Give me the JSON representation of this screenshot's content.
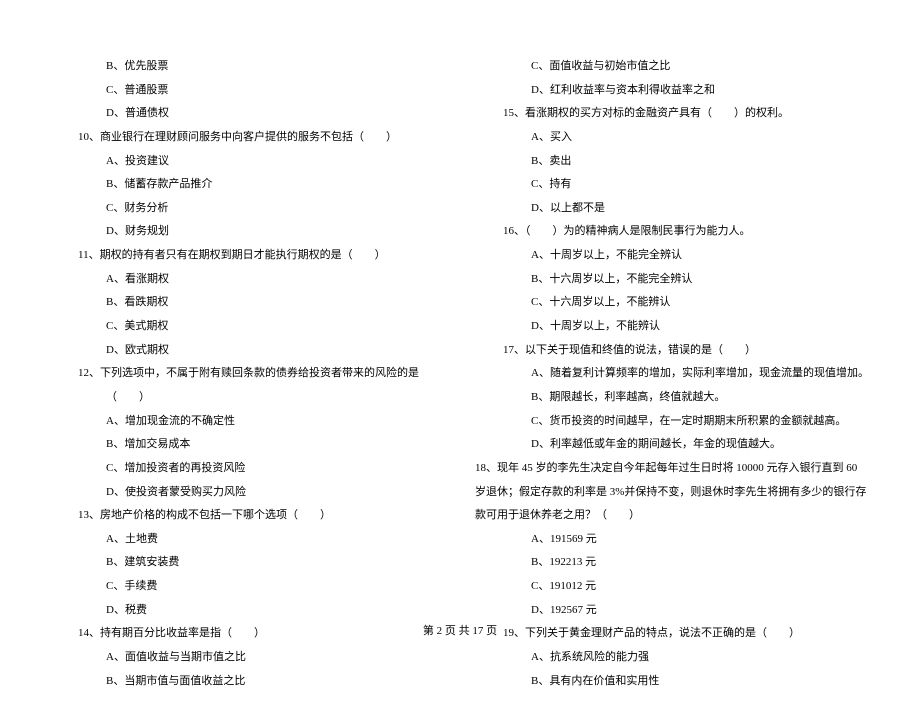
{
  "left": {
    "opts_top": [
      "B、优先股票",
      "C、普通股票",
      "D、普通债权"
    ],
    "q10": "10、商业银行在理财顾问服务中向客户提供的服务不包括（　　）",
    "q10_opts": [
      "A、投资建议",
      "B、储蓄存款产品推介",
      "C、财务分析",
      "D、财务规划"
    ],
    "q11": "11、期权的持有者只有在期权到期日才能执行期权的是（　　）",
    "q11_opts": [
      "A、看涨期权",
      "B、看跌期权",
      "C、美式期权",
      "D、欧式期权"
    ],
    "q12": "12、下列选项中，不属于附有赎回条款的债券给投资者带来的风险的是（　　）",
    "q12_opts": [
      "A、增加现金流的不确定性",
      "B、增加交易成本",
      "C、增加投资者的再投资风险",
      "D、使投资者蒙受购买力风险"
    ],
    "q13": "13、房地产价格的构成不包括一下哪个选项（　　）",
    "q13_opts": [
      "A、土地费",
      "B、建筑安装费",
      "C、手续费",
      "D、税费"
    ],
    "q14": "14、持有期百分比收益率是指（　　）",
    "q14_opts": [
      "A、面值收益与当期市值之比",
      "B、当期市值与面值收益之比"
    ]
  },
  "right": {
    "opts_top": [
      "C、面值收益与初始市值之比",
      "D、红利收益率与资本利得收益率之和"
    ],
    "q15": "15、看涨期权的买方对标的金融资产具有（　　）的权利。",
    "q15_opts": [
      "A、买入",
      "B、卖出",
      "C、持有",
      "D、以上都不是"
    ],
    "q16": "16、（　　）为的精神病人是限制民事行为能力人。",
    "q16_opts": [
      "A、十周岁以上，不能完全辨认",
      "B、十六周岁以上，不能完全辨认",
      "C、十六周岁以上，不能辨认",
      "D、十周岁以上，不能辨认"
    ],
    "q17": "17、以下关于现值和终值的说法，错误的是（　　）",
    "q17_opts": [
      "A、随着复利计算频率的增加，实际利率增加，现金流量的现值增加。",
      "B、期限越长，利率越高，终值就越大。",
      "C、货币投资的时间越早，在一定时期期末所积累的金额就越高。",
      "D、利率越低或年金的期间越长，年金的现值越大。"
    ],
    "q18": "18、现年 45 岁的李先生决定自今年起每年过生日时将 10000 元存入银行直到 60 岁退休；假定存款的利率是 3%并保持不变，则退休时李先生将拥有多少的银行存款可用于退休养老之用？（　　）",
    "q18_opts": [
      "A、191569 元",
      "B、192213 元",
      "C、191012 元",
      "D、192567 元"
    ],
    "q19": "19、下列关于黄金理财产品的特点，说法不正确的是（　　）",
    "q19_opts": [
      "A、抗系统风险的能力强",
      "B、具有内在价值和实用性"
    ]
  },
  "footer": "第 2 页 共 17 页"
}
